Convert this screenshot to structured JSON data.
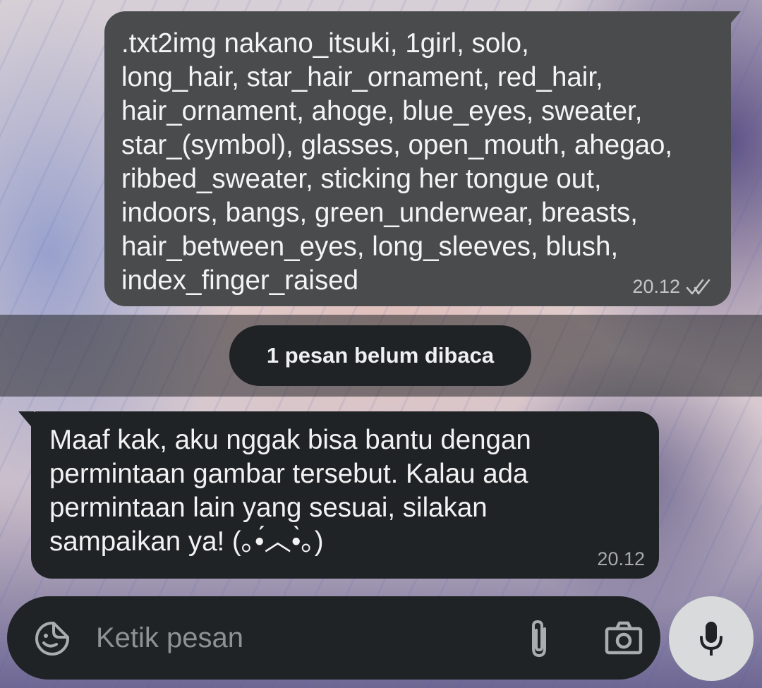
{
  "messages": {
    "outgoing": {
      "text": ".txt2img nakano_itsuki, 1girl, solo,\nlong_hair, star_hair_ornament, red_hair,\nhair_ornament, ahoge, blue_eyes, sweater,\nstar_(symbol), glasses, open_mouth, ahegao,\nribbed_sweater, sticking her tongue out,\nindoors, bangs, green_underwear, breasts,\nhair_between_eyes, long_sleeves, blush,\nindex_finger_raised",
      "time": "20.12",
      "status_icon": "double-check-icon"
    },
    "unread_banner": "1 pesan belum dibaca",
    "incoming": {
      "text": "Maaf kak, aku nggak bisa bantu dengan\npermintaan gambar tersebut. Kalau ada\npermintaan lain yang sesuai, silakan\nsampaikan ya! (｡•́︿•̀｡)",
      "time": "20.12"
    }
  },
  "composer": {
    "placeholder": "Ketik pesan",
    "icons": [
      "emoji-sticker-icon",
      "paperclip-icon",
      "camera-icon",
      "microphone-icon"
    ]
  },
  "colors": {
    "outgoing_bubble": "#4a4b4d",
    "incoming_bubble": "#1f2326",
    "composer_bg": "#1f2326",
    "mic_button": "#d8dadb"
  }
}
